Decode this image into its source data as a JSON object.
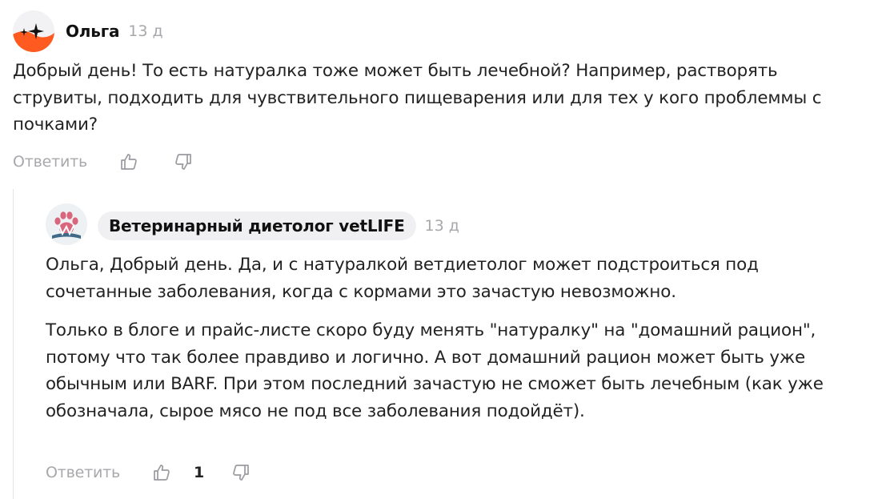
{
  "comments": [
    {
      "author": "Ольга",
      "time": "13 д",
      "avatar_icon": "sparkle-avatar-icon",
      "paragraphs": [
        "Добрый день! То есть натуралка тоже может быть лечебной? Например, растворять струвиты, подходить для чувствительного пищеварения или для тех у кого проблеммы с почками?"
      ],
      "reply_label": "Ответить",
      "likes": ""
    },
    {
      "author": "Ветеринарный диетолог vetLIFE",
      "time": "13 д",
      "avatar_icon": "paw-logo-icon",
      "paragraphs": [
        "Ольга, Добрый день. Да, и с натуралкой ветдиетолог может подстроиться под сочетанные заболевания, когда с кормами это зачастую невозможно.",
        "Только в блоге и прайс-листе скоро буду менять \"натуралку\" на \"домашний рацион\", потому что так более правдиво и логично. А вот домашний рацион может быть уже обычным или BARF. При этом последний зачастую не сможет быть лечебным (как уже обозначала, сырое мясо не под все заболевания подойдёт)."
      ],
      "reply_label": "Ответить",
      "likes": "1"
    }
  ],
  "colors": {
    "muted": "#a8a8ac",
    "text": "#222222",
    "chip_bg": "#f0f0f2",
    "avatar_orange": "#ff5a1f",
    "thread_line": "#e4e4e6"
  }
}
